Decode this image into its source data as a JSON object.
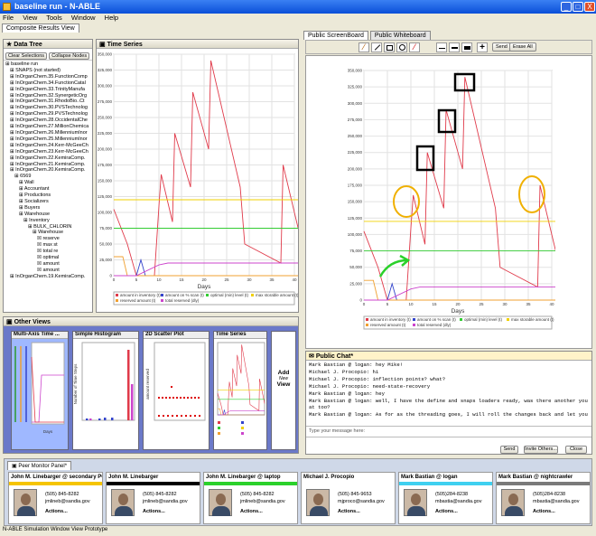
{
  "window": {
    "title": "baseline run - N-ABLE",
    "min": "_",
    "max": "□",
    "close": "X"
  },
  "menu": [
    "File",
    "View",
    "Tools",
    "Window",
    "Help"
  ],
  "tabs": {
    "composite": "Composite Results View"
  },
  "data_tree": {
    "title": "Data Tree",
    "clear": "Clear Selections",
    "collapse": "Collapse Nodes",
    "items": [
      "baseline run",
      "SNAPS (not started)",
      "InOrganChem.35.FunctionComp",
      "InOrganChem.34.FunctionCatal",
      "InOrganChem.33.TrinityManufa",
      "InOrganChem.32.SynergeticOrg",
      "InOrganChem.31.RhodoBio..Ct",
      "InOrganChem.30.PVSTechnolog",
      "InOrganChem.29.PVSTechnolog",
      "InOrganChem.28.OccidentalChe",
      "InOrganChem.27.MillionChemica",
      "InOrganChem.26.MillenniumInor",
      "InOrganChem.25.MillenniumInor",
      "InOrganChem.24.Kerr-McGeeCh",
      "InOrganChem.23.Kerr-McGeeCh",
      "InOrganChem.22.KemiraComp.",
      "InOrganChem.21.KemiraComp.",
      "InOrganChem.20.KemiraComp.",
      "6569",
      "Wall",
      "Accountant",
      "Productions",
      "Socializers",
      "Buyers",
      "Warehouse",
      "Inventory",
      "BULK_CHLORIN",
      "Warehouse",
      "reserve",
      "max st",
      "total re",
      "optimal",
      "amount",
      "amount",
      "InOrganChem.19.KemiraComp."
    ]
  },
  "time_series": {
    "title": "Time Series",
    "xlabel": "Days",
    "legend": [
      "amount in inventory (t)",
      "amount on % scan (t)",
      "optimal (min) level (t)",
      "max storable amount (t)",
      "reserved amount (t)",
      "total reserved (dly)"
    ]
  },
  "other_views": {
    "title": "Other Views",
    "add_label": "Add",
    "add_sub": "New",
    "add_view": "View",
    "views": [
      {
        "title": "Multi-Axis Time ..."
      },
      {
        "title": "Simple Histogram"
      },
      {
        "title": "2D Scatter Plot"
      },
      {
        "title": "Time Series"
      }
    ],
    "hist_ylabel": "Number of Time Steps",
    "scatter_ylabel": "amount reserved",
    "ma_xlabel": "Days"
  },
  "screenboard": {
    "tab1": "Public ScreenBoard",
    "tab2": "Public Whiteboard",
    "send": "Send",
    "erase": "Erase All"
  },
  "chat": {
    "title": "Public Chat*",
    "lines": [
      "Mark Bastian @ logan: hey Mike!",
      "Michael J. Procopio: hi",
      "Michael J. Procopio: inflection points? what?",
      "Michael J. Procopio: need-state-recovery",
      "Mark Bastian @ logan: hey",
      "Mark Bastian @ logan: well, I have the define and snaps loaders ready, was there another you wanted me to look",
      "at too?",
      "Mark Bastian @ logan: As for as the threading goes, I will roll the changes back and let you deal with them."
    ],
    "placeholder": "Type your message here:",
    "send": "Send",
    "invite": "Invite Others...",
    "close": "Close"
  },
  "peer": {
    "title": "Peer Monitor Panel*",
    "cards": [
      {
        "name": "John M. Linebarger @ secondary PC",
        "phone": "(505) 845-8282",
        "email": "jmlineb@sandia.gov",
        "actions": "Actions...",
        "color": "#f5c400"
      },
      {
        "name": "John M. Linebarger",
        "phone": "(505) 845-8282",
        "email": "jmlineb@sandia.gov",
        "actions": "Actions...",
        "color": "#000000"
      },
      {
        "name": "John M. Linebarger @ laptop",
        "phone": "(505) 845-8282",
        "email": "jmlineb@sandia.gov",
        "actions": "Actions...",
        "color": "#2bd12b"
      },
      {
        "name": "Michael J. Procopio",
        "phone": "(505) 845-9653",
        "email": "mjproco@sandia.gov",
        "actions": "Actions...",
        "color": "#ffffff"
      },
      {
        "name": "Mark Bastian @ logan",
        "phone": "(505)284-8238",
        "email": "mbastia@sandia.gov",
        "actions": "Actions...",
        "color": "#3fd0f0"
      },
      {
        "name": "Mark Bastian @ nightcrawler",
        "phone": "(505)284-8238",
        "email": "mbastia@sandia.gov",
        "actions": "Actions...",
        "color": "#7a7a7a"
      }
    ]
  },
  "status": "N-ABLE Simulation Window View Prototype",
  "chart_data": {
    "type": "line",
    "title": "",
    "xlabel": "Days",
    "ylabel": "",
    "xlim": [
      0,
      40
    ],
    "ylim": [
      0,
      350000
    ],
    "xticks": [
      0,
      5,
      10,
      15,
      20,
      25,
      30,
      35,
      40
    ],
    "yticks": [
      0,
      25000,
      50000,
      75000,
      100000,
      125000,
      150000,
      175000,
      200000,
      225000,
      250000,
      275000,
      300000,
      325000,
      350000
    ],
    "series": [
      {
        "name": "amount in inventory (t)",
        "color": "#e03a4a",
        "x": [
          0,
          3,
          5,
          9,
          10,
          10.5,
          13,
          13.5,
          17,
          17.5,
          21,
          21.5,
          28,
          29,
          37,
          37.5,
          42
        ],
        "y": [
          105000,
          50000,
          0,
          0,
          110000,
          160000,
          85000,
          225000,
          140000,
          290000,
          200000,
          340000,
          140000,
          50000,
          20000,
          175000,
          55000
        ]
      },
      {
        "name": "amount on % scan (t)",
        "color": "#3344cc",
        "x": [
          0,
          5,
          6,
          7,
          42
        ],
        "y": [
          0,
          0,
          25000,
          0,
          0
        ]
      },
      {
        "name": "optimal (min) level (t)",
        "color": "#33cc33",
        "x": [
          0,
          42
        ],
        "y": [
          75000,
          75000
        ]
      },
      {
        "name": "max storable amount (t)",
        "color": "#f0d000",
        "x": [
          0,
          42
        ],
        "y": [
          120000,
          120000
        ]
      },
      {
        "name": "reserved amount (t)",
        "color": "#f0a030",
        "x": [
          0,
          2,
          3,
          42
        ],
        "y": [
          30000,
          30000,
          0,
          0
        ]
      },
      {
        "name": "total reserved (dly)",
        "color": "#cc44cc",
        "x": [
          0,
          5,
          10,
          12,
          42
        ],
        "y": [
          0,
          0,
          17000,
          20000,
          20000
        ]
      }
    ]
  }
}
